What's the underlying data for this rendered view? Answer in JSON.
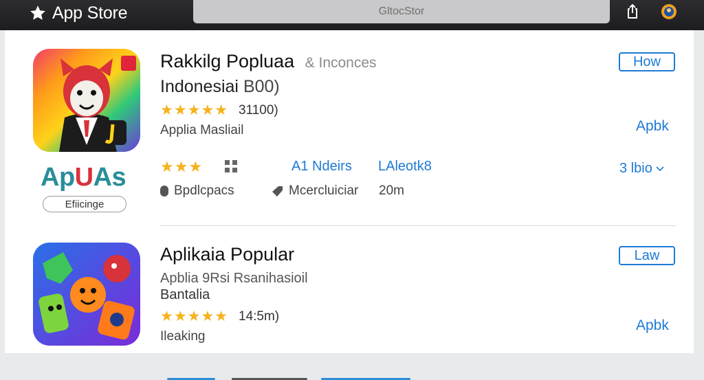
{
  "topbar": {
    "brand_label": "App Store",
    "search_placeholder": "GltocStor"
  },
  "apps": [
    {
      "title": "Rakkilg Popluaa",
      "title_suffix": "& Inconces",
      "subtitle": "Indonesiai",
      "subtitle_suffix": "B00)",
      "rating_stars": 4.5,
      "stars_text": "★★★★★",
      "rating_count": "31100)",
      "developer": "Applia Masliail",
      "get_label": "How",
      "side_link": "Apbk",
      "wordmark": [
        "Ap",
        "U",
        "As"
      ],
      "edit_label": "Efiicinge",
      "row_stars_text": "★★★",
      "link_a": "A1 Ndeirs",
      "link_b": "LAleotk8",
      "more_label": "3 lbio",
      "meta_a": "Bpdlcpacs",
      "meta_b": "Mcercluiciar",
      "meta_c": "20m"
    },
    {
      "title": "Aplikaia Popular",
      "subtitle": "Apblia 9Rsi Rsanihasioil",
      "subtitle2": "Bantalia",
      "rating_stars": 5,
      "stars_text": "★★★★★",
      "rating_count": "14:5m)",
      "developer": "Ileaking",
      "get_label": "Law",
      "side_link": "Apbk"
    }
  ],
  "colors": {
    "accent": "#1e7ad6",
    "star": "#f5b31c",
    "topbar": "#1d1d1f",
    "wordmark_teal": "#2a8d9a",
    "wordmark_red": "#d8323a"
  },
  "icons": [
    "star-icon",
    "share-icon",
    "profile-icon",
    "chevron-down-icon",
    "tag-icon",
    "grid-icon"
  ]
}
